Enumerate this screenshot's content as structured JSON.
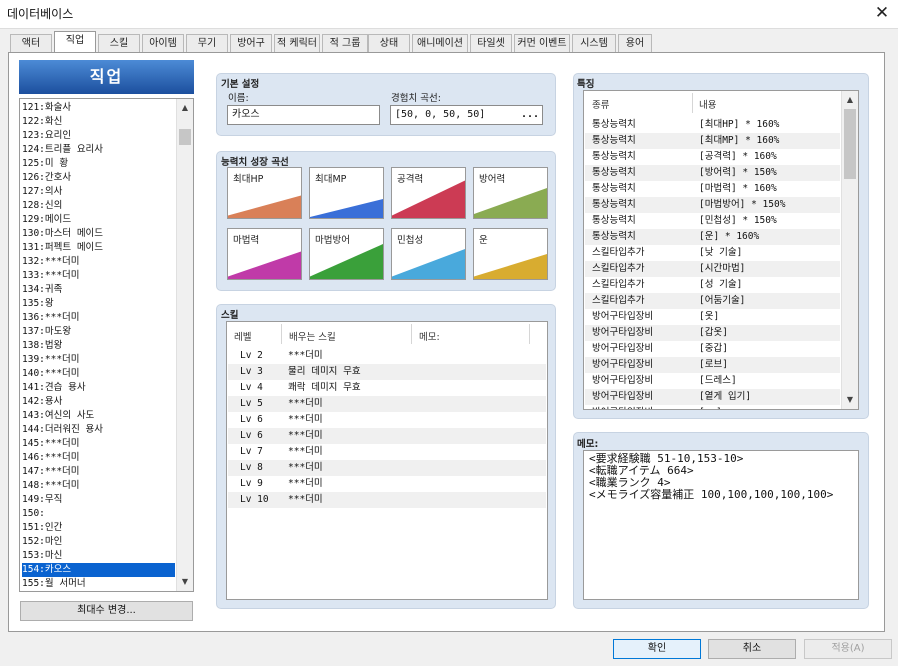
{
  "window": {
    "title": "데이터베이스"
  },
  "tabs": [
    "액터",
    "직업",
    "스킬",
    "아이템",
    "무기",
    "방어구",
    "적 케릭터",
    "적 그룹",
    "상태",
    "애니메이션",
    "타일셋",
    "커먼 이벤트",
    "시스템",
    "용어"
  ],
  "active_tab": "직업",
  "left_panel": {
    "header": "직업",
    "items": [
      "121:화술사",
      "122:화신",
      "123:요리인",
      "124:트리플 요리사",
      "125:미 황",
      "126:간호사",
      "127:의사",
      "128:신의",
      "129:메이드",
      "130:마스터 메이드",
      "131:퍼펙트 메이드",
      "132:***더미",
      "133:***더미",
      "134:귀족",
      "135:왕",
      "136:***더미",
      "137:마도왕",
      "138:법왕",
      "139:***더미",
      "140:***더미",
      "141:견습 용사",
      "142:용사",
      "143:여신의 사도",
      "144:더러워진 용사",
      "145:***더미",
      "146:***더미",
      "147:***더미",
      "148:***더미",
      "149:무직",
      "150:",
      "151:인간",
      "152:마인",
      "153:마신",
      "154:카오스",
      "155:월 서머너"
    ],
    "selected": "154:카오스",
    "max_button": "최대수 변경..."
  },
  "basic": {
    "group": "기본 설정",
    "name_label": "이름:",
    "name_value": "카오스",
    "exp_label": "경험치 곡선:",
    "exp_value": "[50, 0, 50, 50]",
    "exp_btn": "..."
  },
  "params": {
    "group": "능력치 성장 곡선",
    "curves": [
      {
        "label": "최대HP",
        "color": "#d98058",
        "start": 0.05,
        "end": 0.45
      },
      {
        "label": "최대MP",
        "color": "#3a6fd8",
        "start": 0.02,
        "end": 0.38
      },
      {
        "label": "공격력",
        "color": "#cc3b54",
        "start": 0.05,
        "end": 0.75
      },
      {
        "label": "방어력",
        "color": "#8aab52",
        "start": 0.08,
        "end": 0.6
      },
      {
        "label": "마법력",
        "color": "#c03aa8",
        "start": 0.05,
        "end": 0.55
      },
      {
        "label": "마법방어",
        "color": "#3aa03a",
        "start": 0.05,
        "end": 0.7
      },
      {
        "label": "민첩성",
        "color": "#49a9dc",
        "start": 0.05,
        "end": 0.6
      },
      {
        "label": "운",
        "color": "#d8ac30",
        "start": 0.05,
        "end": 0.5
      }
    ]
  },
  "skills": {
    "group": "스킬",
    "col_level": "레벨",
    "col_skill": "배우는 스킬",
    "col_memo": "메모:",
    "rows": [
      {
        "level": "Lv  2",
        "skill": "***더미"
      },
      {
        "level": "Lv  3",
        "skill": "물리 데미지 무효"
      },
      {
        "level": "Lv  4",
        "skill": "쾌락 데미지 무효"
      },
      {
        "level": "Lv  5",
        "skill": "***더미"
      },
      {
        "level": "Lv  6",
        "skill": "***더미"
      },
      {
        "level": "Lv  6",
        "skill": "***더미"
      },
      {
        "level": "Lv  7",
        "skill": "***더미"
      },
      {
        "level": "Lv  8",
        "skill": "***더미"
      },
      {
        "level": "Lv  9",
        "skill": "***더미"
      },
      {
        "level": "Lv 10",
        "skill": "***더미"
      }
    ]
  },
  "traits": {
    "group": "특징",
    "col_type": "종류",
    "col_content": "내용",
    "rows": [
      {
        "type": "통상능력치",
        "content": "[최대HP] * 160%"
      },
      {
        "type": "통상능력치",
        "content": "[최대MP] * 160%"
      },
      {
        "type": "통상능력치",
        "content": "[공격력] * 160%"
      },
      {
        "type": "통상능력치",
        "content": "[방어력] * 150%"
      },
      {
        "type": "통상능력치",
        "content": "[마법력] * 160%"
      },
      {
        "type": "통상능력치",
        "content": "[마법방어] * 150%"
      },
      {
        "type": "통상능력치",
        "content": "[민첩성] * 150%"
      },
      {
        "type": "통상능력치",
        "content": "[운] * 160%"
      },
      {
        "type": "스킬타입추가",
        "content": "[낮 기술]"
      },
      {
        "type": "스킬타입추가",
        "content": "[시간마법]"
      },
      {
        "type": "스킬타입추가",
        "content": "[성 기술]"
      },
      {
        "type": "스킬타입추가",
        "content": "[어둠기술]"
      },
      {
        "type": "방어구타입장비",
        "content": "[옷]"
      },
      {
        "type": "방어구타입장비",
        "content": "[갑옷]"
      },
      {
        "type": "방어구타입장비",
        "content": "[중갑]"
      },
      {
        "type": "방어구타입장비",
        "content": "[로브]"
      },
      {
        "type": "방어구타입장비",
        "content": "[드레스]"
      },
      {
        "type": "방어구타입장비",
        "content": "[옅게 입기]"
      },
      {
        "type": "방어구타입장비",
        "content": "[..]"
      }
    ]
  },
  "memo": {
    "group": "메모:",
    "text": "<要求経験職 51-10,153-10>\n<転職アイテム 664>\n<職業ランク 4>\n<メモライズ容量補正 100,100,100,100,100>"
  },
  "buttons": {
    "ok": "확인",
    "cancel": "취소",
    "apply": "적용(A)"
  }
}
